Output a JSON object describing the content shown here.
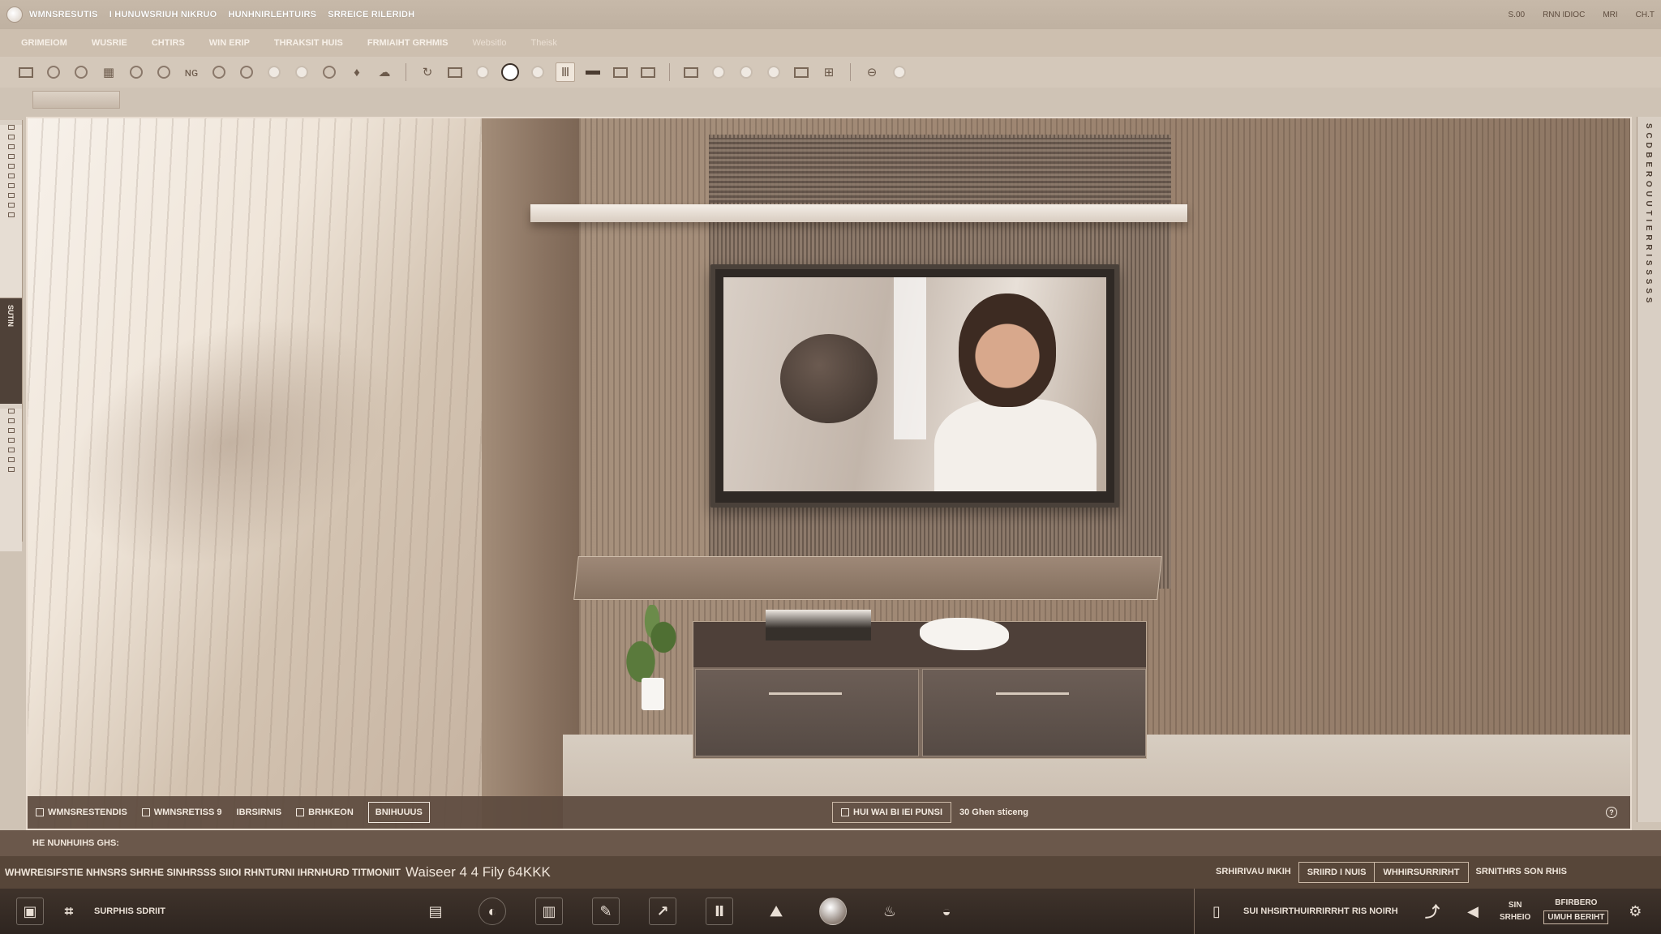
{
  "titlebar": {
    "tabs": [
      "WMNSRESUTIS",
      "I HUNUWSRIUH NIKRUO",
      "HUNHNIRLEHTUIRS",
      "SRREICE RILERIDH"
    ],
    "right_items": [
      "S.00",
      "RNN IDIOC",
      "MRI",
      "CH.T"
    ]
  },
  "menubar": {
    "items": [
      "GRIMEIOM",
      "WUSRIE",
      "CHTIRS",
      "WIN ERIP",
      "THRAKSIT HUIS",
      "FRMIAIHT GRHMIS",
      "Websitlo",
      "Theisk"
    ]
  },
  "left_panel": {
    "label": "SUTIN"
  },
  "right_panel": {
    "label": "S C D B E R O U U T I E R R I S S S S S"
  },
  "viewport_status": {
    "item1": "WMNSRESTENDIS",
    "item2": "WMNSRETISS",
    "item2_count": "9",
    "item3": "IBRSIRNIS",
    "item4": "BRHKEON",
    "item5_boxed": "BNIHUUUS",
    "mid_cell": "HUI WAI BI IEI PUNSI",
    "mid_text": "30 Ghen sticeng",
    "help": "?"
  },
  "status_row1": {
    "text": "HE NUNHUIHS GHS:"
  },
  "status_row2": {
    "items": "WHWREISIFSTIE  NHNSRS  SHRHE  SINHRSSS  SIIOI  RHNTURNI  IHRNHURD  TITMONIIT",
    "strong": "Waiseer 4 4 Fily 64KKK",
    "right_label": "SRHIRIVAU INKIH",
    "right_tab1": "SRIIRD I NUIS",
    "right_tab2": "WHHIRSURRIRHT",
    "right_tab3": "SRNITHRS SON RHIS"
  },
  "bottombar": {
    "left_label": "SURPHIS SDRIIT",
    "right_label": "SUI NHSIRTHUIRRIRRHT RIS NOIRH",
    "right_col1_top": "SIN",
    "right_col1_bottom": "SRHEIO",
    "right_col2_top": "BFIRBERO",
    "right_col2_bottom": "UMUH BERIHT"
  },
  "icons": {
    "toolbar": [
      "square-icon",
      "circle-icon",
      "circle-icon",
      "grid-icon",
      "circle-icon",
      "circle-icon",
      "text-icon",
      "circle-icon",
      "circle-icon",
      "circle-icon",
      "circle-icon",
      "circle-icon",
      "pin-icon",
      "cloud-icon",
      "rotate-icon",
      "list-icon",
      "circle-icon",
      "circle-icon",
      "circle-icon",
      "bars-icon",
      "bar-icon",
      "frame-icon",
      "window-icon",
      "doc-icon",
      "circle-icon",
      "circle-icon",
      "circle-icon",
      "square-icon",
      "table-icon",
      "minus-icon",
      "circle-icon"
    ]
  }
}
